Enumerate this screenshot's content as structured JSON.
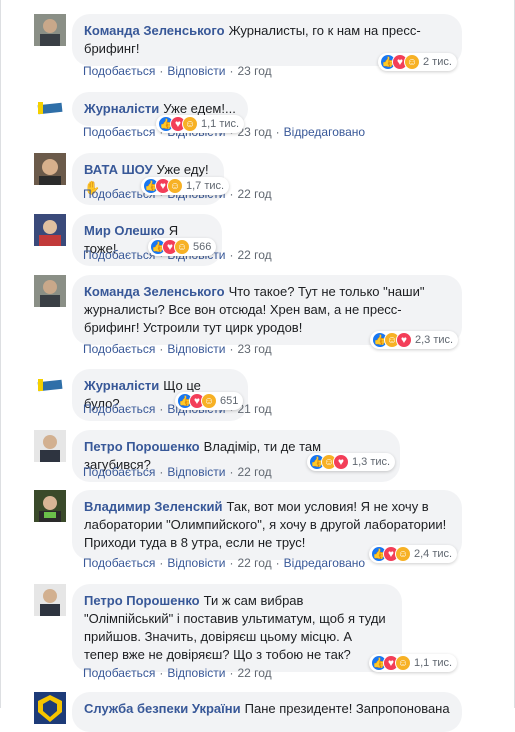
{
  "labels": {
    "like": "Подобається",
    "reply": "Відповісти",
    "edited": "Відредаговано"
  },
  "comments": [
    {
      "author": "Команда Зеленського",
      "text": "Журналисты, го к нам на пресс-брифинг!",
      "time": "23 год",
      "reactions": "2 тис."
    },
    {
      "author": "Журналісти",
      "text": "Уже едем!...",
      "time": "23 год",
      "reactions": "1,1 тис."
    },
    {
      "author": "ВАТА ШОУ",
      "text": "Уже еду!",
      "time": "22 год",
      "reactions": "1,7 тис."
    },
    {
      "author": "Мир Олешко",
      "text": "Я тоже!",
      "time": "22 год",
      "reactions": "566"
    },
    {
      "author": "Команда Зеленського",
      "text": "Что такое? Тут не только \"наши\" журналисты? Все вон отсюда! Хрен вам, а не пресс-брифинг! Устроили тут цирк уродов!",
      "time": "23 год",
      "reactions": "2,3 тис."
    },
    {
      "author": "Журналісти",
      "text": "Що це було?",
      "time": "21 год",
      "reactions": "651"
    },
    {
      "author": "Петро Порошенко",
      "text": "Владімір, ти де там загубився?",
      "time": "22 год",
      "reactions": "1,3 тис."
    },
    {
      "author": "Владимир Зеленский",
      "text": "Так, вот мои условия! Я не хочу в лаборатории \"Олимпийского\", я хочу в другой лаборатории! Приходи туда в 8 утра, если не трус!",
      "time": "22 год",
      "reactions": "2,4 тис."
    },
    {
      "author": "Петро Порошенко",
      "text": "Ти ж сам вибрав \"Олімпійський\" і поставив ультиматум, щоб я туди прийшов. Значить, довіряєш цьому місцю. А тепер вже не довіряєш? Що з тобою не так?",
      "time": "22 год",
      "reactions": "1,1 тис."
    },
    {
      "author": "Служба безпеки України",
      "text": "Пане президенте! Запропонована"
    }
  ],
  "colors": {
    "name": "#385898",
    "bubble": "#f2f3f5",
    "like": "#1877f2",
    "love": "#f33e58",
    "haha": "#f7b125"
  }
}
